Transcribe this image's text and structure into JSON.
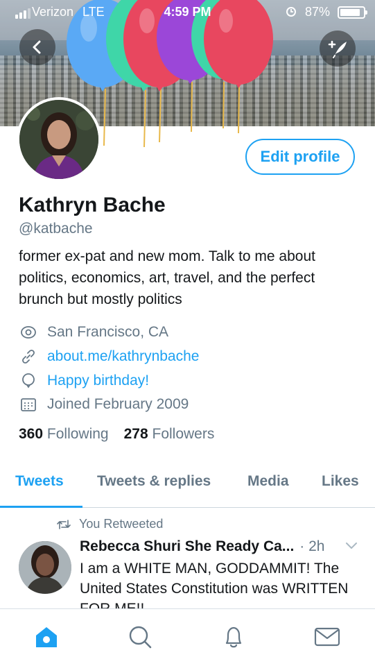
{
  "status_bar": {
    "carrier": "Verizon",
    "network": "LTE",
    "time": "4:59 PM",
    "battery": "87%",
    "battery_level": 0.87
  },
  "header": {
    "back_icon": "chevron-left-icon",
    "compose_icon": "compose-tweet-icon",
    "balloon_colors": [
      "#5aa9f5",
      "#3fd6a8",
      "#e8475f",
      "#9b47d8",
      "#3fd6a8",
      "#e8475f"
    ]
  },
  "profile": {
    "edit_button": "Edit profile",
    "name": "Kathryn Bache",
    "handle": "@katbache",
    "bio": "former ex-pat and new mom. Talk to me about politics, economics, art, travel, and the perfect brunch but mostly politics",
    "location": "San Francisco, CA",
    "url": "about.me/kathrynbache",
    "birthday": "Happy birthday!",
    "joined": "Joined February 2009",
    "following_count": "360",
    "following_label": "Following",
    "followers_count": "278",
    "followers_label": "Followers"
  },
  "tabs": [
    {
      "label": "Tweets",
      "active": true
    },
    {
      "label": "Tweets & replies",
      "active": false
    },
    {
      "label": "Media",
      "active": false
    },
    {
      "label": "Likes",
      "active": false
    }
  ],
  "timeline": {
    "retweet_label": "You Retweeted",
    "tweet": {
      "author": "Rebecca Shuri She Ready Ca...",
      "time": "· 2h",
      "text": "I am a WHITE MAN, GODDAMMIT! The United States Constitution was WRITTEN FOR ME!!"
    }
  },
  "tab_bar": {
    "items": [
      "home-icon",
      "search-icon",
      "notifications-icon",
      "messages-icon"
    ]
  },
  "colors": {
    "accent": "#1da1f2",
    "muted": "#657786",
    "text": "#14171a"
  }
}
